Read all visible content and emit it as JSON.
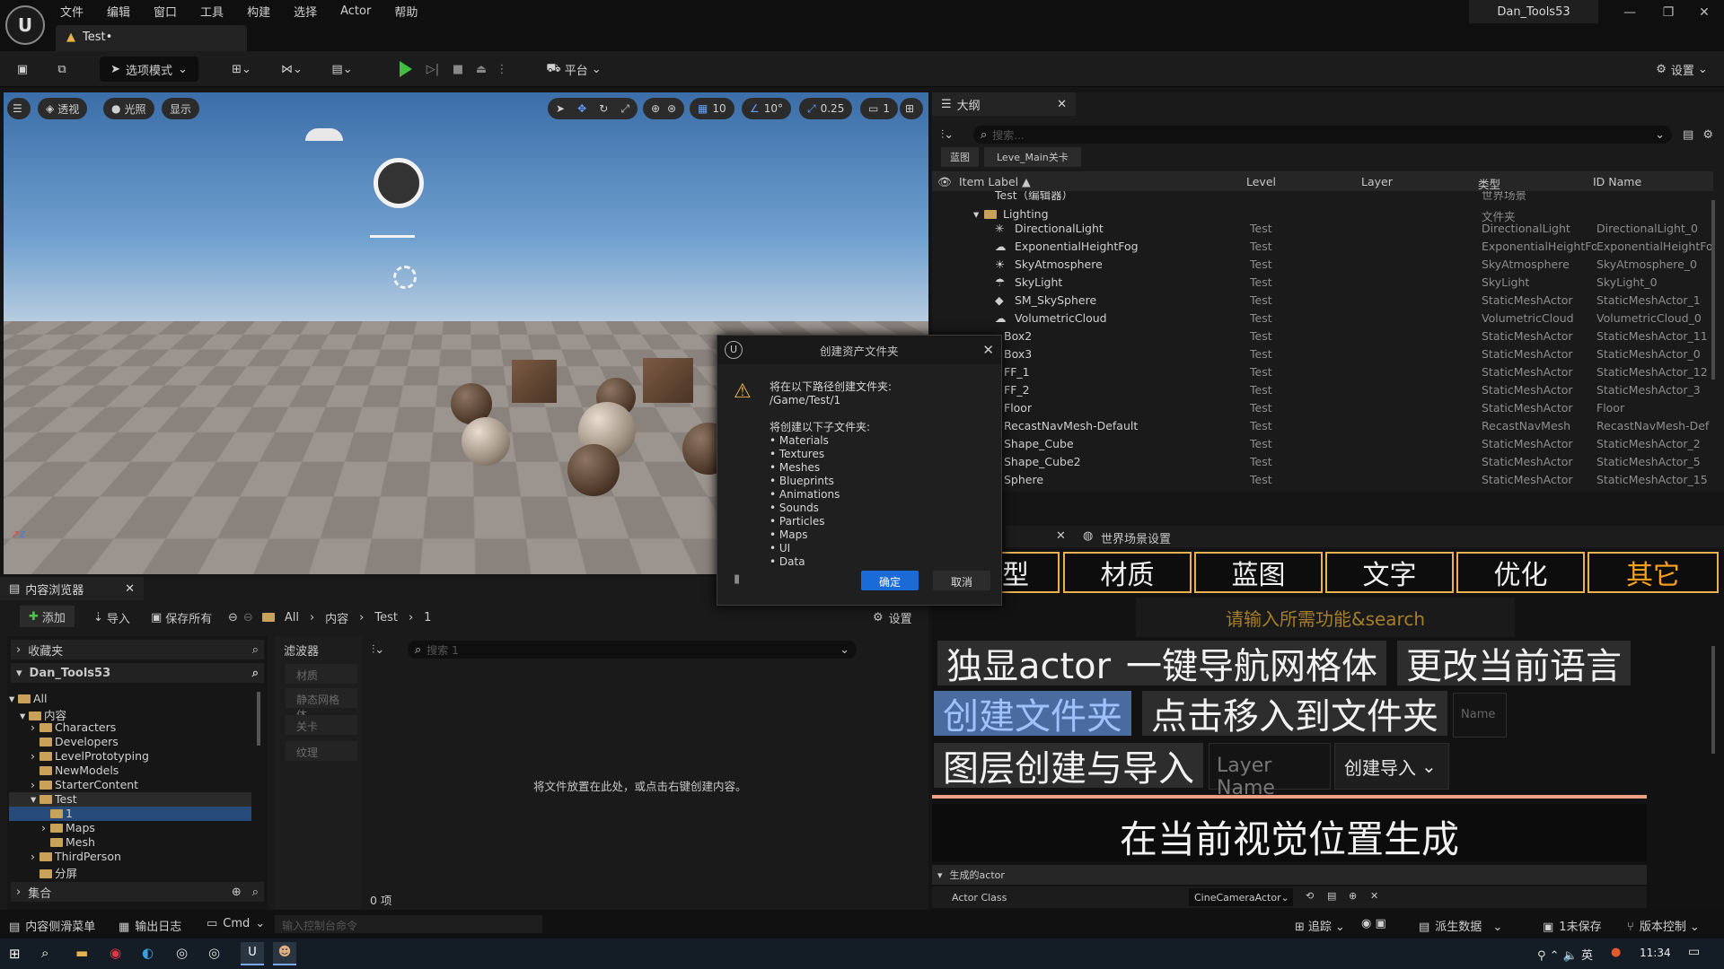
{
  "menu": [
    "文件",
    "编辑",
    "窗口",
    "工具",
    "构建",
    "选择",
    "Actor",
    "帮助"
  ],
  "level_tab": "Test•",
  "project_name": "Dan_Tools53",
  "toolbar": {
    "mode": "选项模式",
    "platform": "平台",
    "settings": "设置"
  },
  "viewport": {
    "perspective": "透视",
    "lighting": "光照",
    "show": "显示",
    "grid": "10",
    "angle": "10°",
    "scale": "0.25",
    "camera_speed": "1"
  },
  "outliner": {
    "title": "大纲",
    "search_placeholder": "搜索...",
    "filters": [
      "蓝图",
      "Leve_Main关卡"
    ],
    "columns": [
      "Item Label ▲",
      "Level",
      "Layer",
      "类型",
      "ID Name"
    ],
    "root": {
      "label": "Test（编辑器）",
      "type": "世界场景"
    },
    "folder": {
      "label": "Lighting",
      "type": "文件夹"
    },
    "rows": [
      {
        "label": "DirectionalLight",
        "level": "Test",
        "type": "DirectionalLight",
        "id": "DirectionalLight_0"
      },
      {
        "label": "ExponentialHeightFog",
        "level": "Test",
        "type": "ExponentialHeightFog",
        "id": "ExponentialHeightFog"
      },
      {
        "label": "SkyAtmosphere",
        "level": "Test",
        "type": "SkyAtmosphere",
        "id": "SkyAtmosphere_0"
      },
      {
        "label": "SkyLight",
        "level": "Test",
        "type": "SkyLight",
        "id": "SkyLight_0"
      },
      {
        "label": "SM_SkySphere",
        "level": "Test",
        "type": "StaticMeshActor",
        "id": "StaticMeshActor_1"
      },
      {
        "label": "VolumetricCloud",
        "level": "Test",
        "type": "VolumetricCloud",
        "id": "VolumetricCloud_0"
      },
      {
        "label": "Box2",
        "level": "Test",
        "type": "StaticMeshActor",
        "id": "StaticMeshActor_11"
      },
      {
        "label": "Box3",
        "level": "Test",
        "type": "StaticMeshActor",
        "id": "StaticMeshActor_0"
      },
      {
        "label": "FF_1",
        "level": "Test",
        "type": "StaticMeshActor",
        "id": "StaticMeshActor_12"
      },
      {
        "label": "FF_2",
        "level": "Test",
        "type": "StaticMeshActor",
        "id": "StaticMeshActor_3"
      },
      {
        "label": "Floor",
        "level": "Test",
        "type": "StaticMeshActor",
        "id": "Floor"
      },
      {
        "label": "RecastNavMesh-Default",
        "level": "Test",
        "type": "RecastNavMesh",
        "id": "RecastNavMesh-Def"
      },
      {
        "label": "Shape_Cube",
        "level": "Test",
        "type": "StaticMeshActor",
        "id": "StaticMeshActor_2"
      },
      {
        "label": "Shape_Cube2",
        "level": "Test",
        "type": "StaticMeshActor",
        "id": "StaticMeshActor_5"
      },
      {
        "label": "Sphere",
        "level": "Test",
        "type": "StaticMeshActor",
        "id": "StaticMeshActor_15"
      }
    ]
  },
  "world_settings_tab": "世界场景设置",
  "tools": {
    "categories": [
      "型",
      "材质",
      "蓝图",
      "文字",
      "优化",
      "其它"
    ],
    "search_placeholder": "请输入所需功能&search",
    "isolate": "独显actor",
    "navmesh": "一键导航网格体",
    "language": "更改当前语言",
    "create_folder": "创建文件夹",
    "move_to_folder": "点击移入到文件夹",
    "name_placeholder": "Name",
    "layer_create": "图层创建与导入",
    "layer_placeholder": "Layer Name",
    "create_import": "创建导入",
    "spawn": "在当前视觉位置生成",
    "spawn_section": "生成的actor",
    "actor_class_label": "Actor Class",
    "actor_class_value": "CineCameraActor"
  },
  "content_browser": {
    "title": "内容浏览器",
    "add": "添加",
    "import": "导入",
    "save_all": "保存所有",
    "path": [
      "All",
      "内容",
      "Test",
      "1"
    ],
    "settings": "设置",
    "favorites": "收藏夹",
    "project": "Dan_Tools53",
    "tree": [
      "All",
      "内容",
      "Characters",
      "Developers",
      "LevelPrototyping",
      "NewModels",
      "StarterContent",
      "Test",
      "1",
      "Maps",
      "Mesh",
      "ThirdPerson",
      "分屏"
    ],
    "collections": "集合",
    "filters_title": "滤波器",
    "filters": [
      "材质",
      "静态网格体",
      "关卡",
      "纹理"
    ],
    "search_placeholder": "搜索 1",
    "empty_hint": "将文件放置在此处，或点击右键创建内容。",
    "item_count": "0 项"
  },
  "dialog": {
    "title": "创建资产文件夹",
    "line1": "将在以下路径创建文件夹:",
    "path": "/Game/Test/1",
    "line2": "将创建以下子文件夹:",
    "items": [
      "• Materials",
      "• Textures",
      "• Meshes",
      "• Blueprints",
      "• Animations",
      "• Sounds",
      "• Particles",
      "• Maps",
      "• UI",
      "• Data"
    ],
    "ok": "确定",
    "cancel": "取消"
  },
  "status": {
    "drawer": "内容侧滑菜单",
    "output": "输出日志",
    "cmd": "Cmd",
    "console_placeholder": "输入控制台命令",
    "trace": "追踪",
    "derived": "派生数据",
    "unsaved": "1未保存",
    "source": "版本控制"
  },
  "taskbar": {
    "time": "11:34"
  }
}
